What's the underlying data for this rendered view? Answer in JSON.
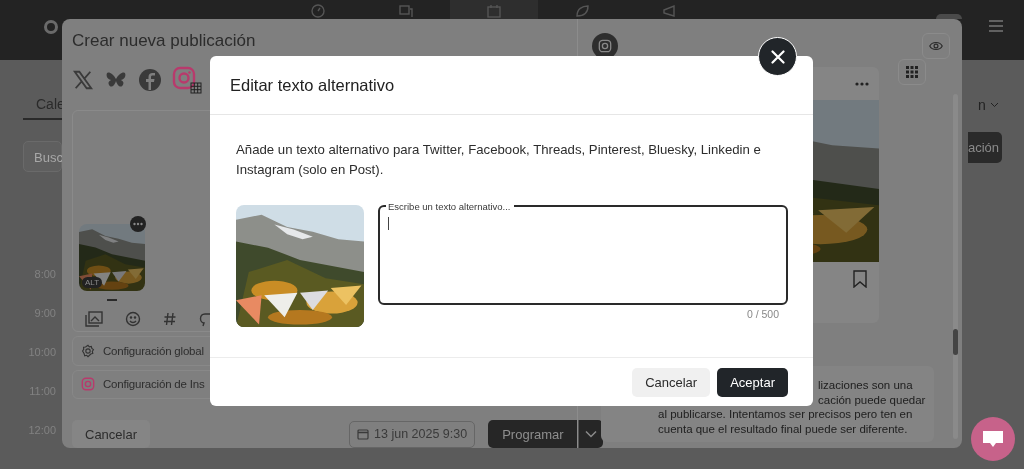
{
  "app": {
    "tab": "Cale",
    "search_placeholder": "Busc",
    "times": [
      "8:00",
      "9:00",
      "10:00",
      "11:00",
      "12:00"
    ],
    "dropdown_label": "n",
    "action_button": "ación"
  },
  "create_post": {
    "title": "Crear nueva publicación",
    "networks": [
      {
        "kind": "x",
        "selected": false
      },
      {
        "kind": "bluesky",
        "selected": false
      },
      {
        "kind": "facebook",
        "selected": false
      },
      {
        "kind": "instagram",
        "selected": true
      }
    ],
    "media_badge": "ALT",
    "settings": [
      {
        "kind": "global",
        "label": "Configuración global"
      },
      {
        "kind": "instagram",
        "label": "Configuración de Ins"
      }
    ],
    "cancel": "Cancelar",
    "date": "13 jun 2025 9:30",
    "schedule": "Programar"
  },
  "preview": {
    "note_lines": [
      "lizaciones son una",
      "cación puede quedar",
      "al publicarse. Intentamos ser precisos pero ten en",
      "cuenta que el resultado final puede ser diferente."
    ]
  },
  "alt_dialog": {
    "title": "Editar texto alternativo",
    "description": "Añade un texto alternativo para Twitter, Facebook, Threads, Pinterest, Bluesky, Linkedin e Instagram (solo en Post).",
    "field_label": "Escribe un texto alternativo...",
    "counter": "0 / 500",
    "buttons": [
      {
        "label": "Cancelar",
        "kind": "secondary"
      },
      {
        "label": "Aceptar",
        "kind": "primary"
      }
    ]
  }
}
